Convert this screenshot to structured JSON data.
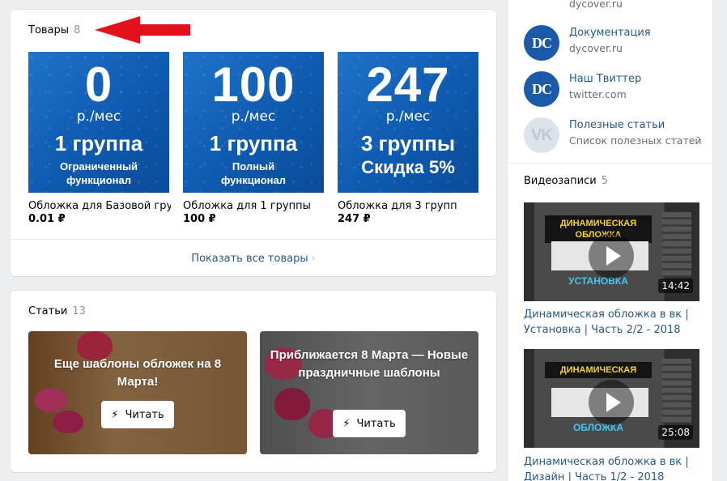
{
  "products": {
    "title": "Товары",
    "count": "8",
    "items": [
      {
        "num": "0",
        "per": "р./мес",
        "groups": "1 группа",
        "sub": "Ограниченный функционал",
        "name": "Обложка для Базовой гру...",
        "price": "0.01 ₽"
      },
      {
        "num": "100",
        "per": "р./мес",
        "groups": "1 группа",
        "sub": "Полный функционал",
        "name": "Обложка для 1 группы",
        "price": "100 ₽"
      },
      {
        "num": "247",
        "per": "р./мес",
        "groups": "3 группы",
        "sub": "Скидка 5%",
        "name": "Обложка для 3 групп",
        "price": "247 ₽"
      }
    ],
    "show_all": "Показать все товары"
  },
  "articles": {
    "title": "Статьи",
    "count": "13",
    "items": [
      {
        "title": "Еще шаблоны обложек на 8 Марта!",
        "read": "Читать"
      },
      {
        "title": "Приближается 8 Марта — Новые праздничные шаблоны",
        "read": "Читать"
      }
    ]
  },
  "sidebar": {
    "top_sub": "dycover.ru",
    "links": [
      {
        "avatar": "DC",
        "title": "Документация",
        "sub": "dycover.ru"
      },
      {
        "avatar": "DC",
        "title": "Наш Твиттер",
        "sub": "twitter.com"
      },
      {
        "avatar": "VK",
        "title": "Полезные статьи",
        "sub": "Список полезных статей"
      }
    ],
    "videos_title": "Видеозаписи",
    "videos_count": "5",
    "videos": [
      {
        "thumb_top": "ДИНАМИЧЕСКАЯ ОБЛОЖКА",
        "thumb_bottom": "УСТАНОВКА",
        "duration": "14:42",
        "title": "Динамическая обложка в вк | Установка | Часть 2/2 - 2018"
      },
      {
        "thumb_top": "ДИНАМИЧЕСКАЯ",
        "thumb_bottom": "ОБЛОЖКА",
        "duration": "25:08",
        "title": "Динамическая обложка в вк | Дизайн | Часть 1/2 - 2018"
      }
    ]
  },
  "colors": {
    "link": "#2a5885",
    "accent_arrow": "#e3111b",
    "tile_blue": "#1565c0"
  }
}
